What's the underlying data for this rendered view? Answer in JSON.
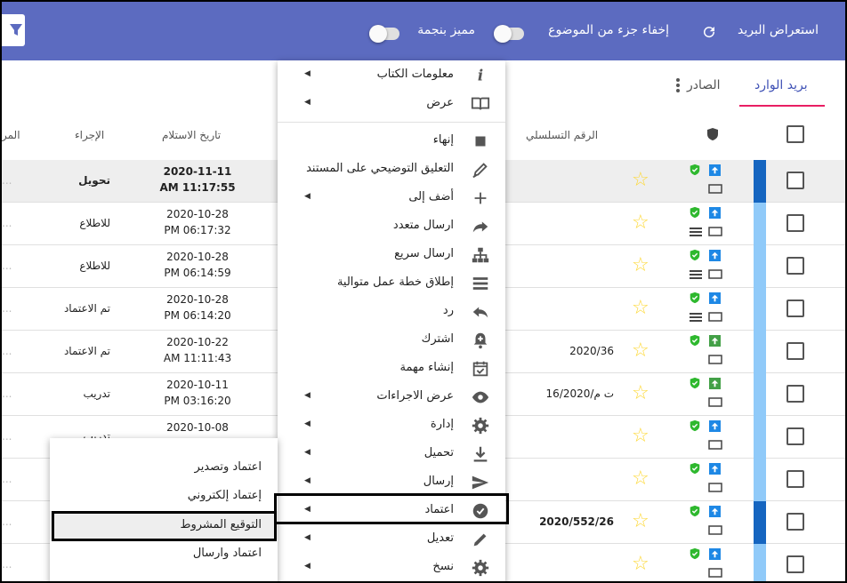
{
  "topbar": {
    "title": "استعراض البريد",
    "hide_subject_label": "إخفاء جزء من الموضوع",
    "starred_label": "مميز بنجمة"
  },
  "tabs": {
    "inbox": "بريد الوارد",
    "outbox": "الصادر"
  },
  "columns": {
    "serial": "الرقم التسلسلي",
    "received_date": "تاريخ الاستلام",
    "action": "الإجراء",
    "sender": "المر"
  },
  "rows": [
    {
      "date": "2020-11-11",
      "time": "AM 11:17:55",
      "action": "تحويل",
      "serial": "",
      "bold": true
    },
    {
      "date": "2020-10-28",
      "time": "PM 06:17:32",
      "action": "للاطلاع",
      "serial": ""
    },
    {
      "date": "2020-10-28",
      "time": "PM 06:14:59",
      "action": "للاطلاع",
      "serial": ""
    },
    {
      "date": "2020-10-28",
      "time": "PM 06:14:20",
      "action": "تم الاعتماد",
      "serial": ""
    },
    {
      "date": "2020-10-22",
      "time": "AM 11:11:43",
      "action": "تم الاعتماد",
      "serial": "2020/36"
    },
    {
      "date": "2020-10-11",
      "time": "PM 03:16:20",
      "action": "تدريب",
      "serial": "ت م/16/2020"
    },
    {
      "date": "2020-10-08",
      "time": "",
      "action": "تدريب",
      "serial": ""
    },
    {
      "date": "",
      "time": "",
      "action": "",
      "serial": ""
    },
    {
      "date": "",
      "time": "",
      "action": "",
      "serial": "2020/552/26",
      "bold": true
    },
    {
      "date": "",
      "time": "",
      "action": "",
      "serial": ""
    }
  ],
  "menu": {
    "items": [
      {
        "label": "معلومات الكتاب",
        "icon": "info-icon",
        "sub": true
      },
      {
        "label": "عرض",
        "icon": "book-open-icon",
        "sub": true
      },
      {
        "label": "إنهاء",
        "icon": "stop-icon",
        "sub": false
      },
      {
        "label": "التعليق التوضيحي على المستند",
        "icon": "annotate-icon",
        "sub": false
      },
      {
        "label": "أضف إلى",
        "icon": "plus-icon",
        "sub": true
      },
      {
        "label": "ارسال متعدد",
        "icon": "forward-icon",
        "sub": false
      },
      {
        "label": "ارسال سريع",
        "icon": "sitemap-icon",
        "sub": false
      },
      {
        "label": "إطلاق خطة عمل متوالية",
        "icon": "list-icon",
        "sub": false
      },
      {
        "label": "رد",
        "icon": "reply-icon",
        "sub": false
      },
      {
        "label": "اشترك",
        "icon": "bell-plus-icon",
        "sub": false
      },
      {
        "label": "إنشاء مهمة",
        "icon": "calendar-check-icon",
        "sub": false
      },
      {
        "label": "عرض الاجراءات",
        "icon": "eye-icon",
        "sub": true
      },
      {
        "label": "إدارة",
        "icon": "gear-icon",
        "sub": true
      },
      {
        "label": "تحميل",
        "icon": "download-icon",
        "sub": true
      },
      {
        "label": "إرسال",
        "icon": "send-icon",
        "sub": true
      },
      {
        "label": "اعتماد",
        "icon": "verified-icon",
        "sub": true
      },
      {
        "label": "تعديل",
        "icon": "pencil-icon",
        "sub": true
      },
      {
        "label": "نسخ",
        "icon": "gear-icon",
        "sub": true
      }
    ]
  },
  "submenu": {
    "items": [
      "اعتماد وتصدير",
      "إعتماد إلكتروني",
      "التوقيع المشروط",
      "اعتماد وارسال"
    ]
  }
}
